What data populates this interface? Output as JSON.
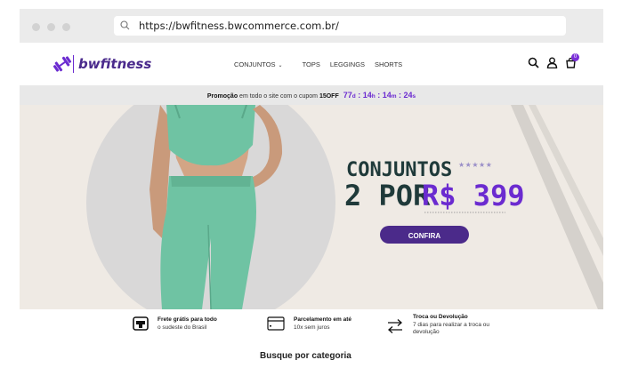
{
  "browser": {
    "url": "https://bwfitness.bwcommerce.com.br/"
  },
  "header": {
    "logo_text": "bwfitness",
    "nav": [
      {
        "label": "CONJUNTOS",
        "has_dropdown": true
      },
      {
        "label": "TOPS",
        "has_dropdown": false
      },
      {
        "label": "LEGGINGS",
        "has_dropdown": false
      },
      {
        "label": "SHORTS",
        "has_dropdown": false
      }
    ],
    "cart_count": "0"
  },
  "promo": {
    "text_prefix": "Promoção",
    "text_middle": " em todo o site com o cupom ",
    "coupon": "15OFF",
    "timer": {
      "days": "77",
      "days_unit": "d",
      "hours": "14",
      "hours_unit": "h",
      "minutes": "14",
      "minutes_unit": "m",
      "seconds": "24",
      "seconds_unit": "s"
    }
  },
  "hero": {
    "headline_1": "CONJUNTOS",
    "headline_2": "2 POR",
    "price": "R$ 399",
    "stars": "★★★★★",
    "cta_label": "CONFIRA"
  },
  "features": [
    {
      "icon": "store-icon",
      "title": "Frete grátis para todo",
      "subtitle": "o sudeste do Brasil"
    },
    {
      "icon": "credit-card-icon",
      "title": "Parcelamento em até",
      "subtitle": "10x sem juros"
    },
    {
      "icon": "exchange-arrows-icon",
      "title": "Troca ou Devolução",
      "subtitle": "7 dias para realizar a troca ou",
      "subtitle_2": "devolução"
    }
  ],
  "category_title": "Busque por categoria",
  "colors": {
    "brand_purple": "#4a2a8c",
    "accent_purple": "#6b2bd0",
    "cta_bg": "#4b2a8a",
    "hero_bg": "#efeae4",
    "headline_dark": "#1f3a3a",
    "outfit_green": "#6fc3a3"
  }
}
